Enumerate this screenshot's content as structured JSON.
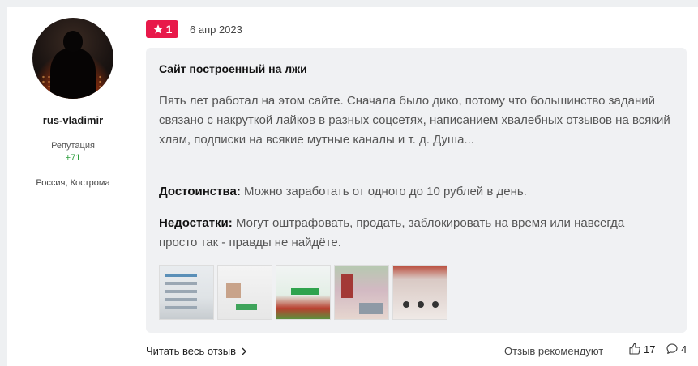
{
  "author": {
    "username": "rus-vladimir",
    "reputation_label": "Репутация",
    "reputation_value": "+71",
    "location": "Россия, Кострома"
  },
  "review": {
    "rating": "1",
    "date": "6 апр 2023",
    "title": "Сайт построенный на лжи",
    "text": "Пять лет работал на этом сайте. Сначала было дико, потому что большинство заданий связано с накруткой лайков в разных соцсетях, написанием хвалебных отзывов на всякий хлам, подписки на всякие мутные каналы и т. д. Душа...",
    "pros_label": "Достоинства:",
    "pros_text": "Можно заработать от одного до 10 рублей в день.",
    "cons_label": "Недостатки:",
    "cons_text": "Могут оштрафовать, продать, заблокировать на время или навсегда просто так - правды не найдёте.",
    "thumbnail_count": 5
  },
  "footer": {
    "read_more": "Читать весь отзыв",
    "recommend_label": "Отзыв рекомендуют",
    "likes": "17",
    "comments": "4"
  },
  "colors": {
    "rating_badge": "#e8194a",
    "reputation": "#2a9d3a",
    "review_bg": "#f0f1f3"
  },
  "icons": {
    "rating": "star-icon",
    "read_more": "chevron-right-icon",
    "likes": "thumbs-up-icon",
    "comments": "comment-icon"
  }
}
